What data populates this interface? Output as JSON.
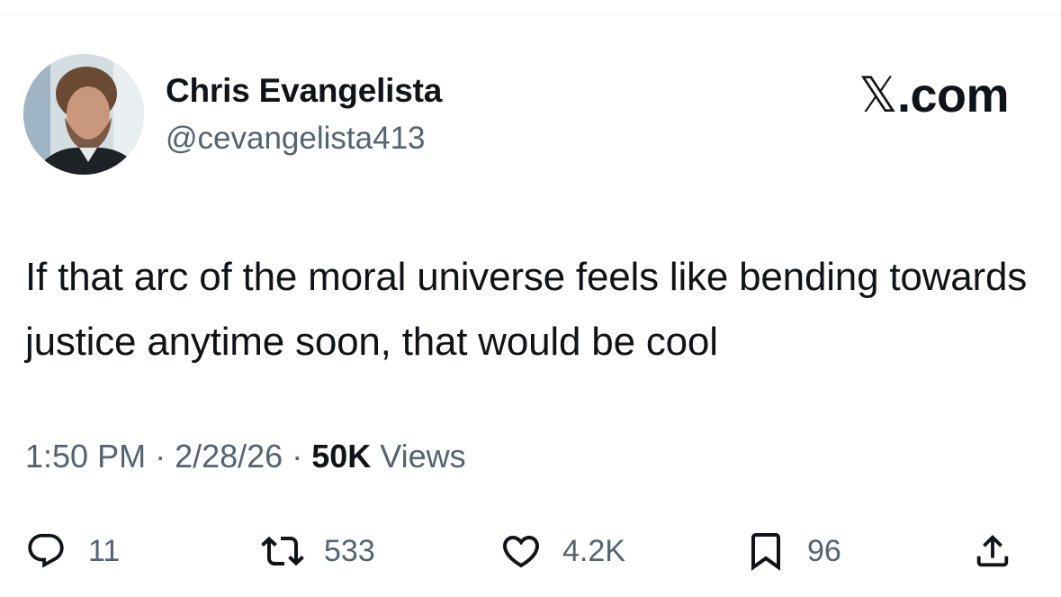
{
  "author": {
    "name": "Chris Evangelista",
    "handle": "@cevangelista413"
  },
  "brand": {
    "mark": "𝕏",
    "suffix": ".com"
  },
  "tweet": {
    "text": "If that arc of the moral universe feels like bending towards justice anytime soon, that would be cool"
  },
  "meta": {
    "time": "1:50 PM",
    "separator": " · ",
    "date": "2/28/26",
    "views_count": "50K",
    "views_label": "Views"
  },
  "actions": {
    "reply": {
      "icon": "reply-icon",
      "count": "11"
    },
    "retweet": {
      "icon": "retweet-icon",
      "count": "533"
    },
    "like": {
      "icon": "heart-icon",
      "count": "4.2K"
    },
    "bookmark": {
      "icon": "bookmark-icon",
      "count": "96"
    },
    "share": {
      "icon": "share-icon"
    }
  },
  "colors": {
    "text_primary": "#0f1419",
    "text_secondary": "#536471",
    "background": "#ffffff"
  }
}
